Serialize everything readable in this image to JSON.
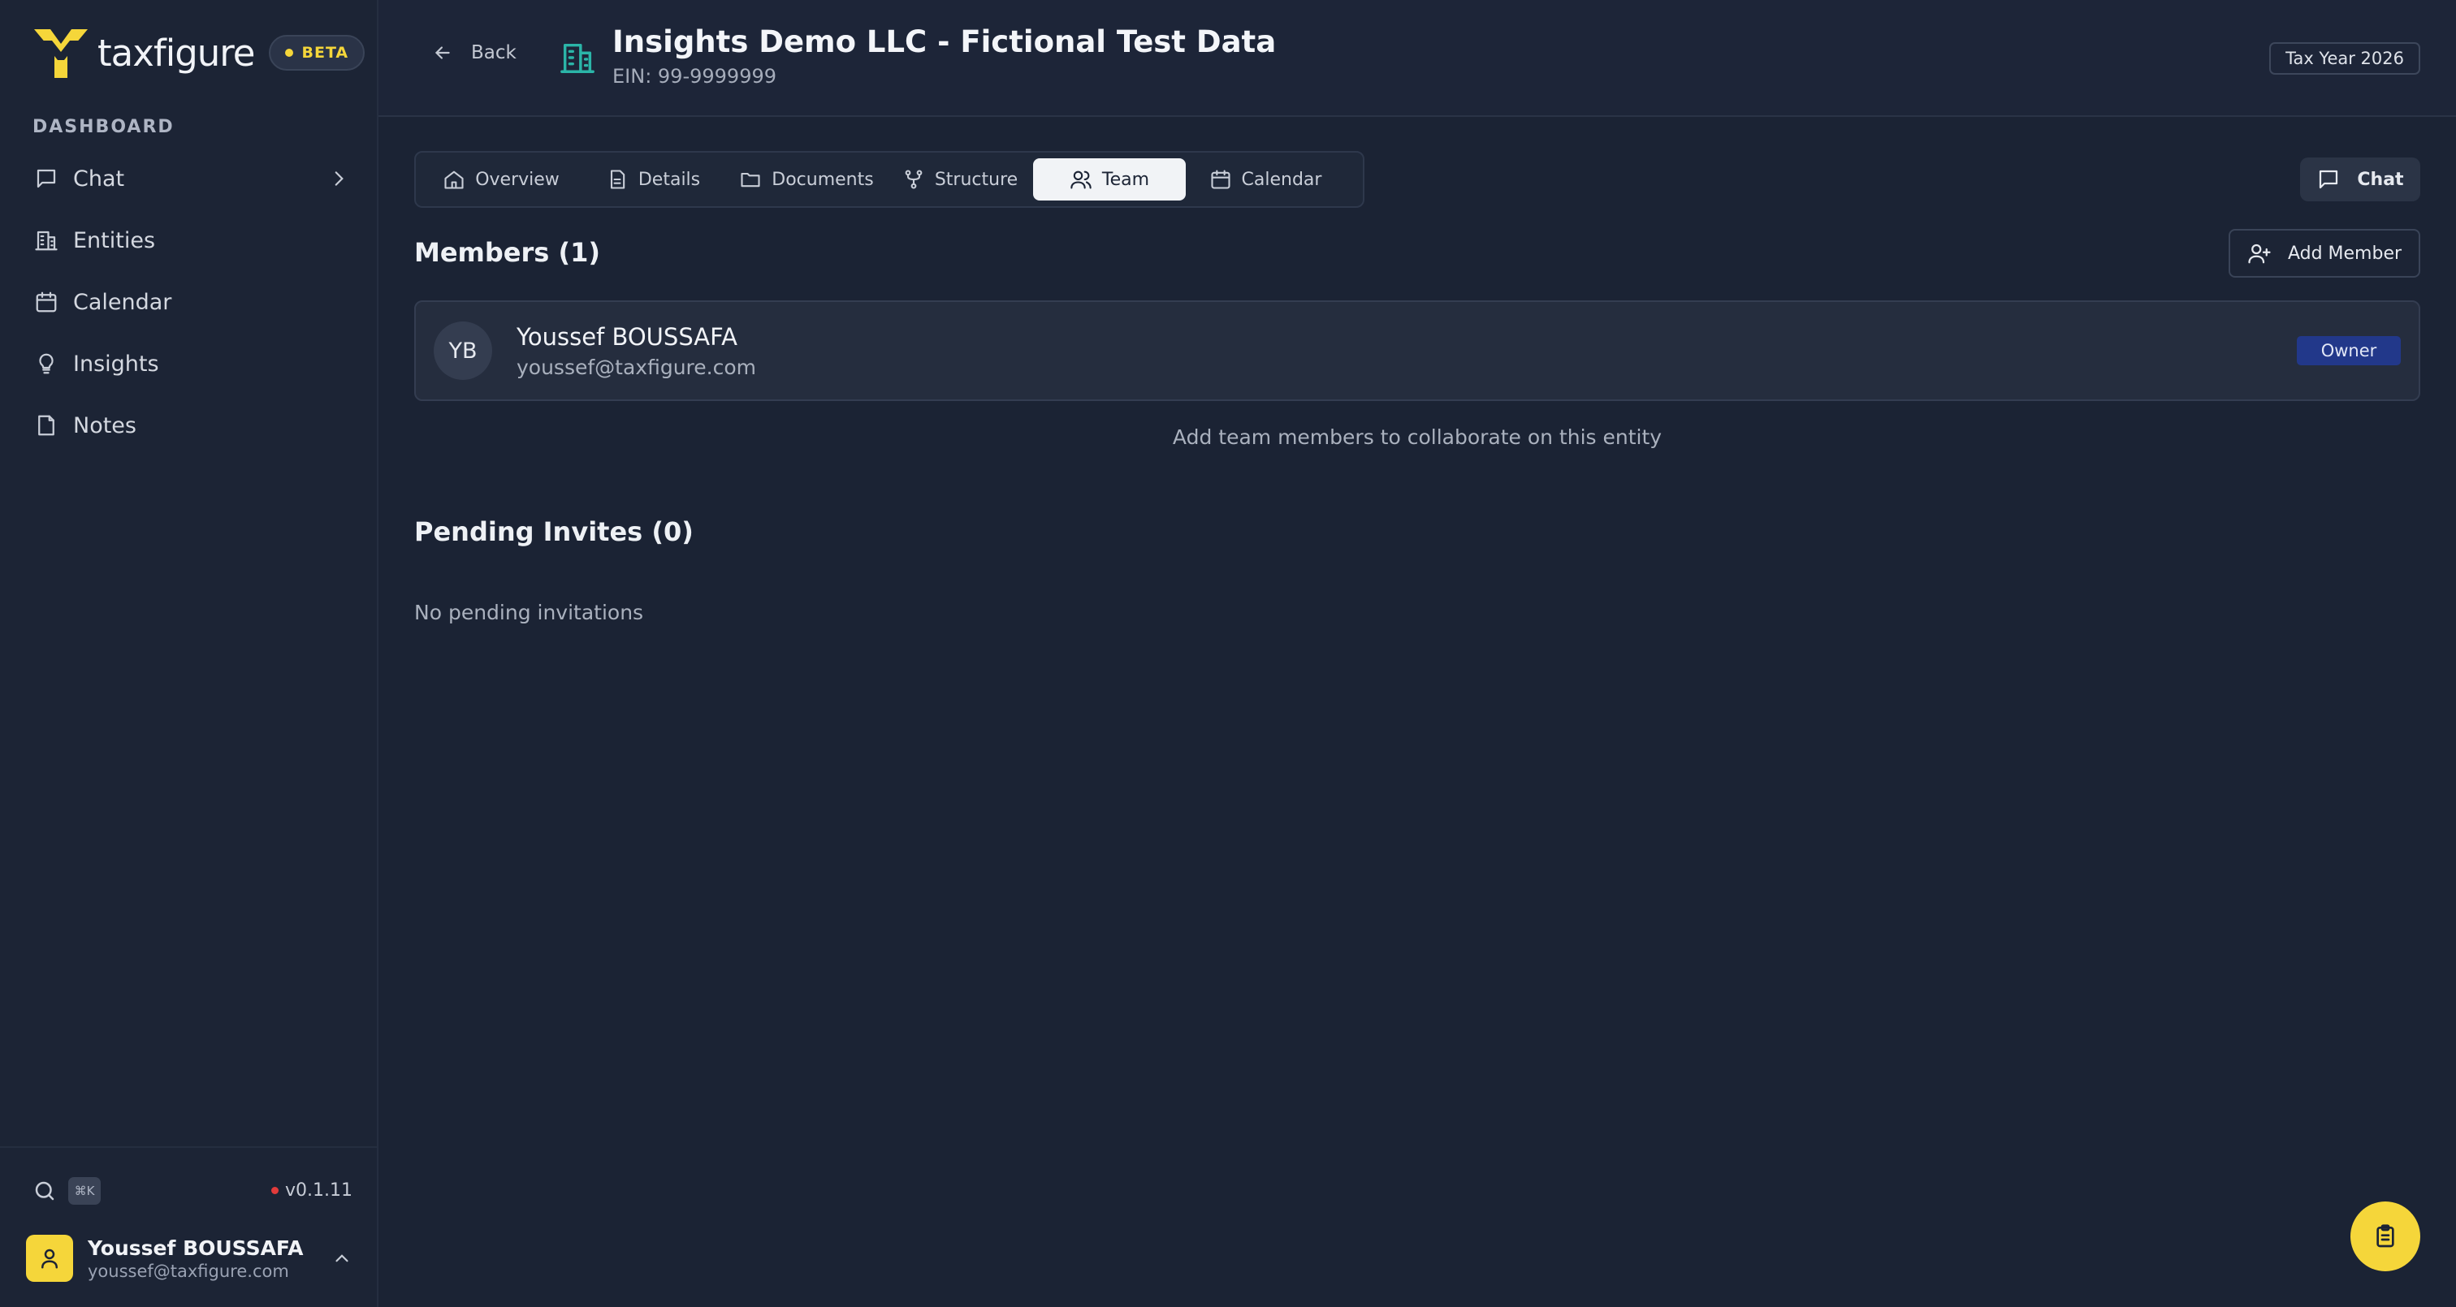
{
  "brand": {
    "name": "taxfigure",
    "badge": "BETA",
    "accent": "#f5d63a"
  },
  "sidebar": {
    "section_label": "DASHBOARD",
    "items": [
      {
        "label": "Chat",
        "icon": "message-square-icon"
      },
      {
        "label": "Entities",
        "icon": "building-icon"
      },
      {
        "label": "Calendar",
        "icon": "calendar-icon"
      },
      {
        "label": "Insights",
        "icon": "lightbulb-icon"
      },
      {
        "label": "Notes",
        "icon": "note-icon"
      }
    ],
    "shortcut": "⌘K",
    "version": "v0.1.11",
    "user": {
      "name": "Youssef BOUSSAFA",
      "email": "youssef@taxfigure.com"
    }
  },
  "header": {
    "back_label": "Back",
    "entity_title": "Insights Demo LLC - Fictional Test Data",
    "ein": "EIN: 99-9999999",
    "tax_year": "Tax Year 2026"
  },
  "tabs": [
    {
      "label": "Overview",
      "icon": "home-icon"
    },
    {
      "label": "Details",
      "icon": "file-text-icon"
    },
    {
      "label": "Documents",
      "icon": "folder-icon"
    },
    {
      "label": "Structure",
      "icon": "git-fork-icon"
    },
    {
      "label": "Team",
      "icon": "users-icon",
      "active": true
    },
    {
      "label": "Calendar",
      "icon": "calendar-icon"
    }
  ],
  "chat_button": "Chat",
  "members": {
    "title": "Members (1)",
    "add_label": "Add Member",
    "list": [
      {
        "initials": "YB",
        "name": "Youssef BOUSSAFA",
        "email": "youssef@taxfigure.com",
        "role": "Owner"
      }
    ],
    "helper": "Add team members to collaborate on this entity"
  },
  "pending": {
    "title": "Pending Invites (0)",
    "empty": "No pending invitations"
  }
}
